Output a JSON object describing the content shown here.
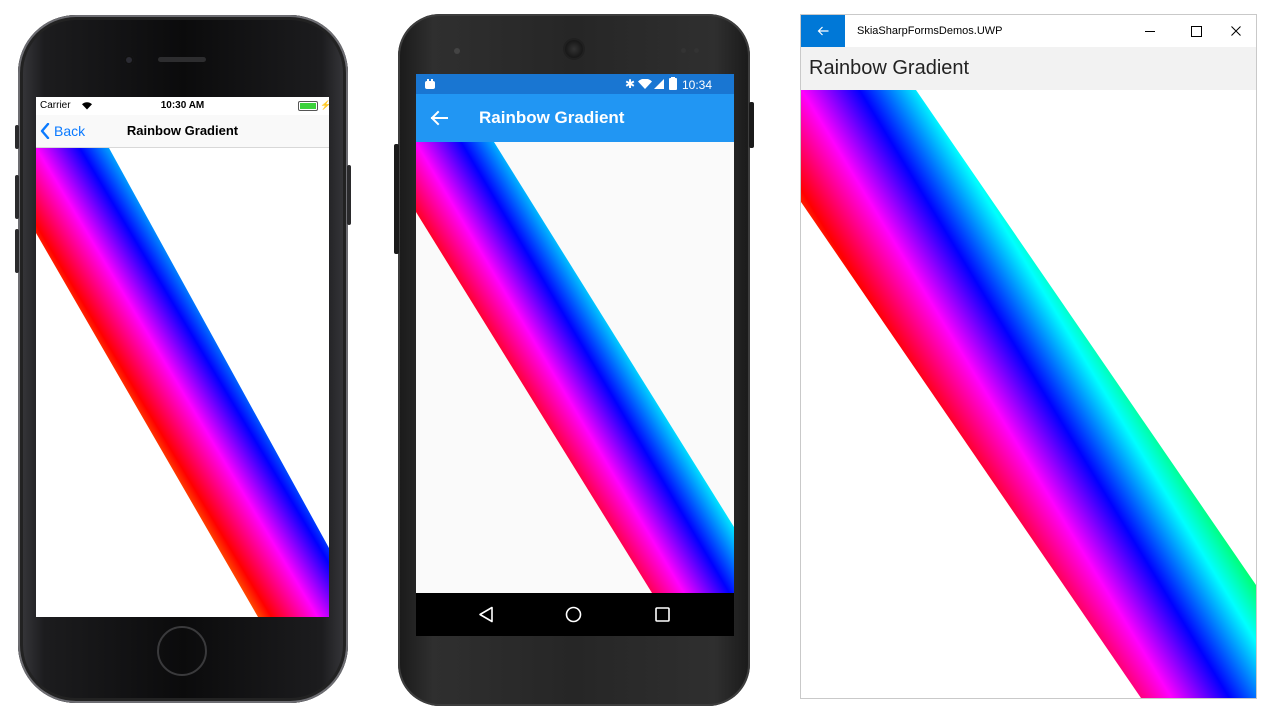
{
  "ios": {
    "carrier": "Carrier",
    "time": "10:30 AM",
    "back_label": "Back",
    "title": "Rainbow Gradient"
  },
  "android": {
    "time": "10:34",
    "title": "Rainbow Gradient"
  },
  "uwp": {
    "window_title": "SkiaSharpFormsDemos.UWP",
    "page_title": "Rainbow Gradient"
  },
  "colors": {
    "ios_tint": "#0a7aff",
    "android_primary": "#2196f3",
    "android_primary_dark": "#1976d2",
    "uwp_accent": "#0078d7",
    "rainbow": [
      "#ff0000",
      "#ffff00",
      "#00ff00",
      "#00ffff",
      "#0000ff",
      "#ff00ff",
      "#ff0000"
    ]
  }
}
